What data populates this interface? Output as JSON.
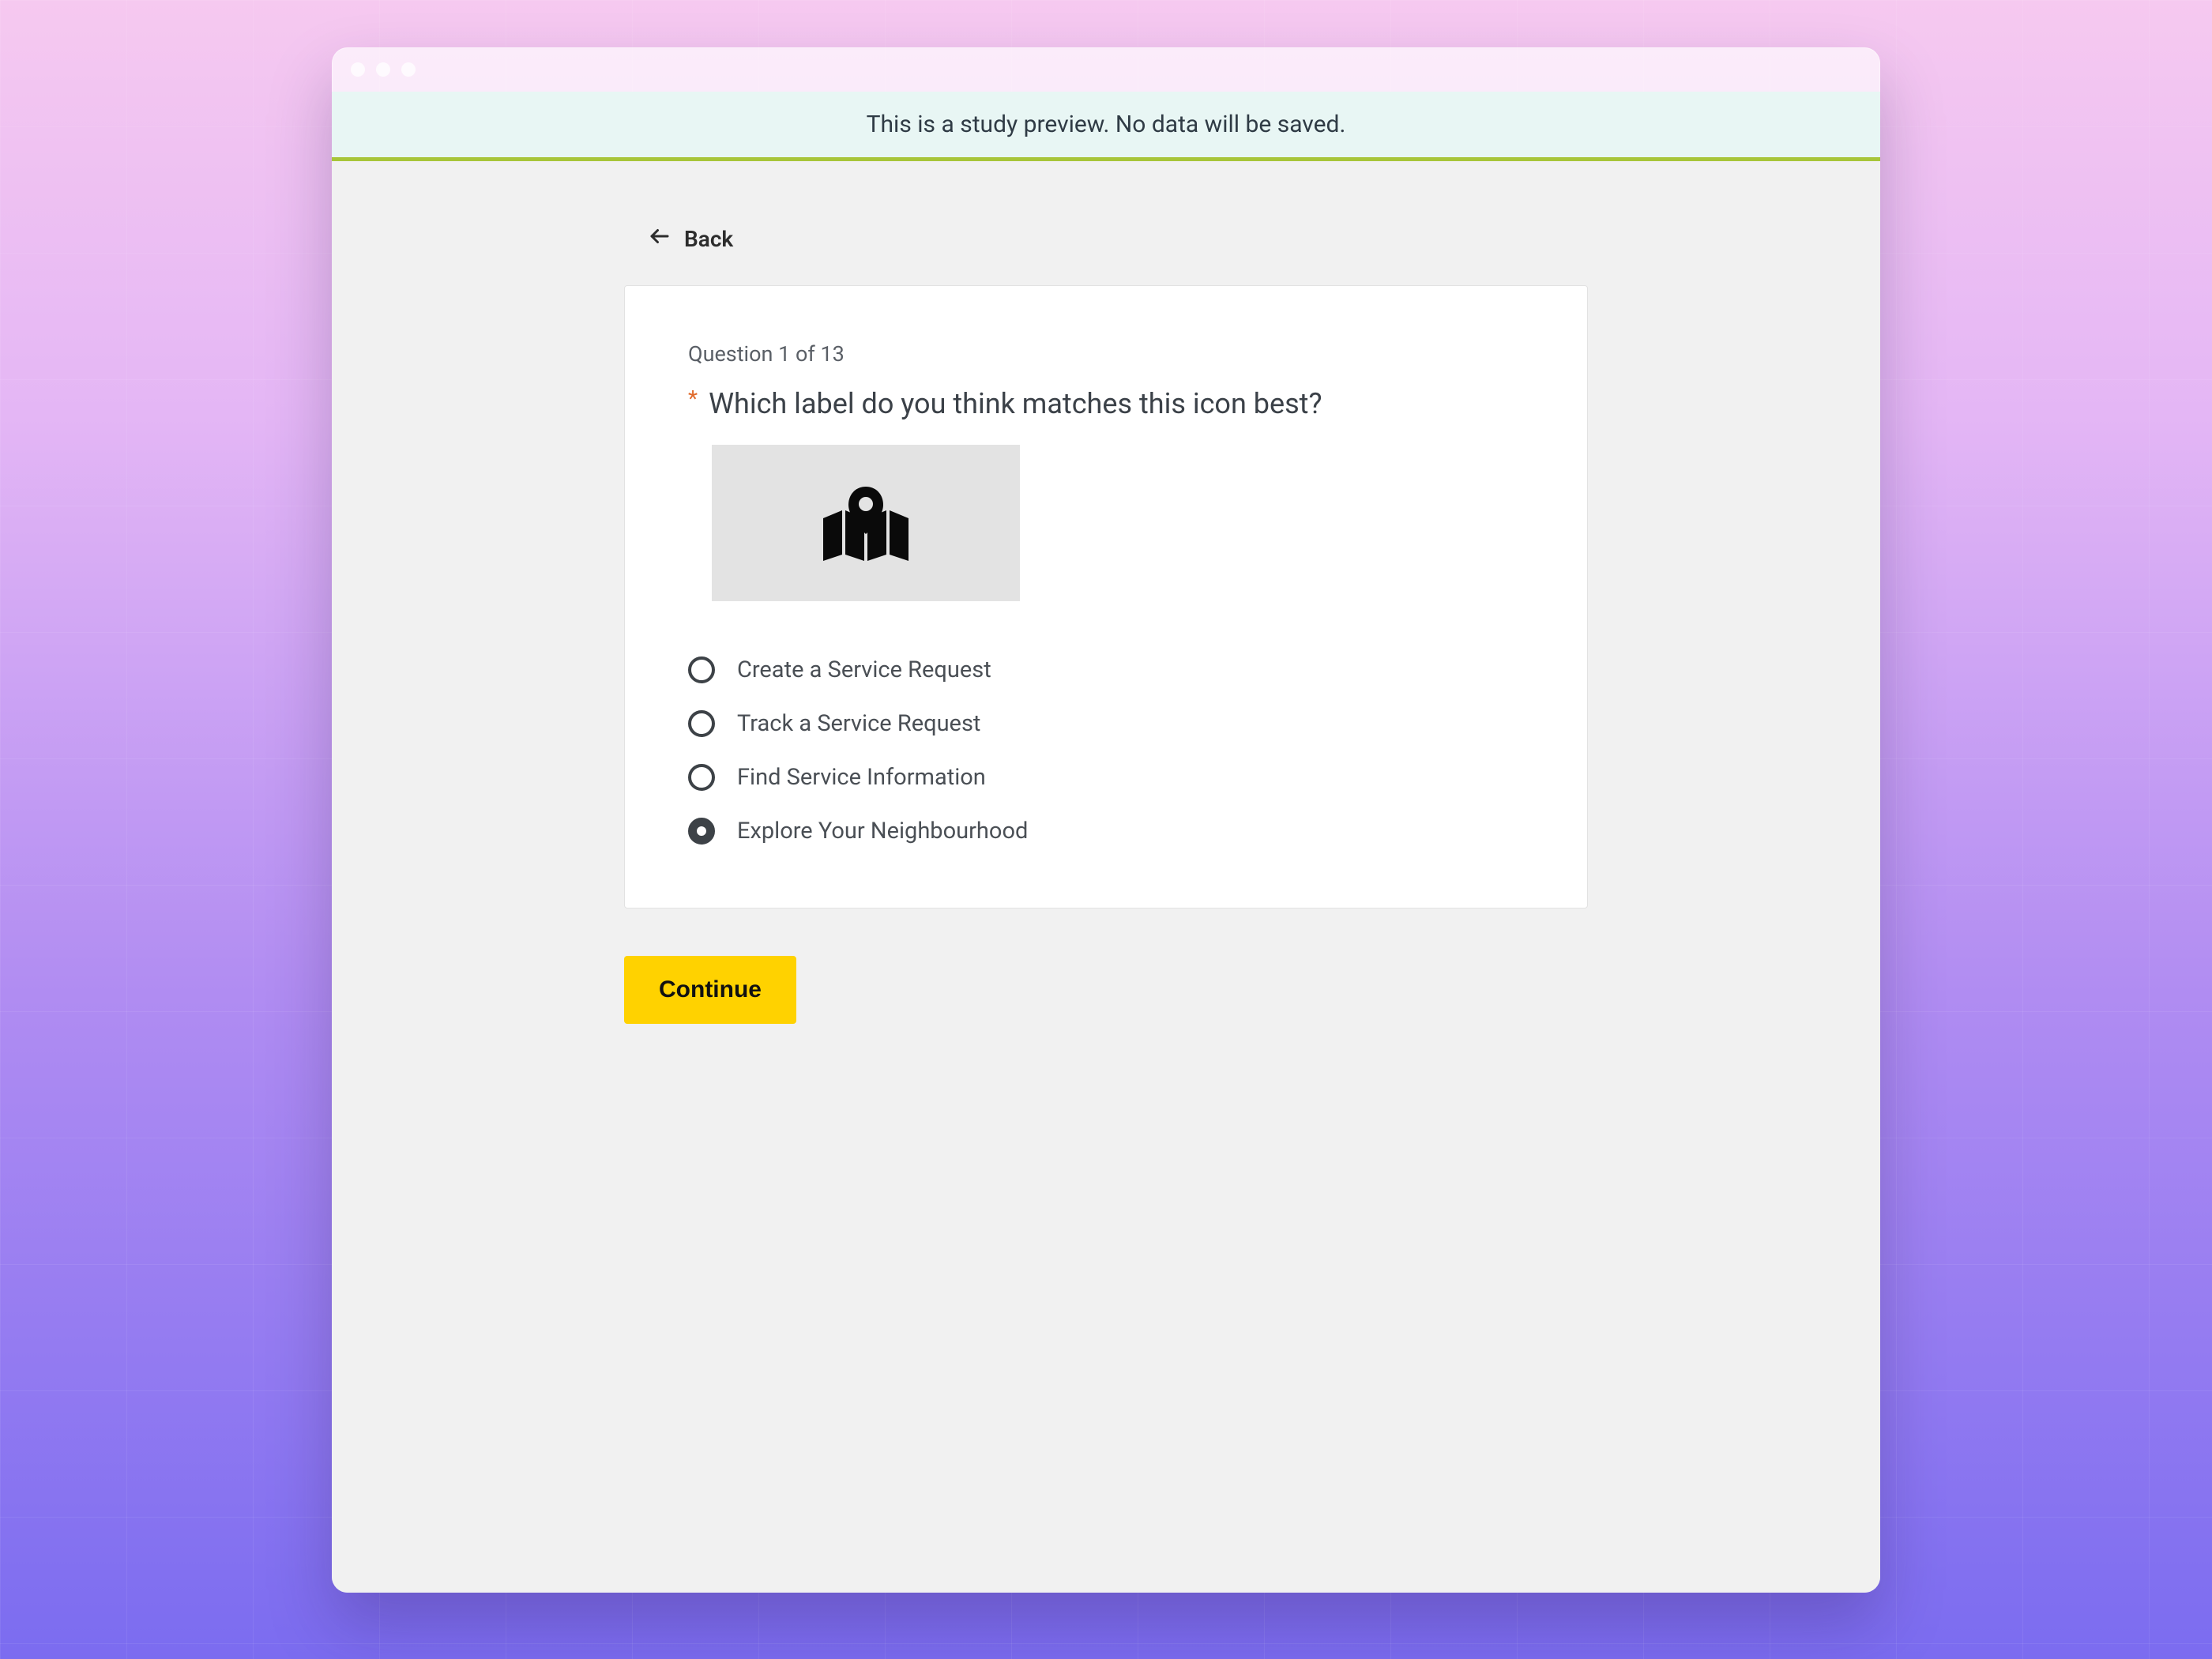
{
  "banner": {
    "text": "This is a study preview. No data will be saved."
  },
  "nav": {
    "back_label": "Back"
  },
  "question": {
    "counter": "Question 1 of 13",
    "required_marker": "*",
    "text": "Which label do you think matches this icon best?",
    "icon_name": "map-marker-icon"
  },
  "options": [
    {
      "label": "Create a Service Request",
      "selected": false
    },
    {
      "label": "Track a Service Request",
      "selected": false
    },
    {
      "label": "Find Service Information",
      "selected": false
    },
    {
      "label": "Explore Your Neighbourhood",
      "selected": true
    }
  ],
  "actions": {
    "continue_label": "Continue"
  }
}
